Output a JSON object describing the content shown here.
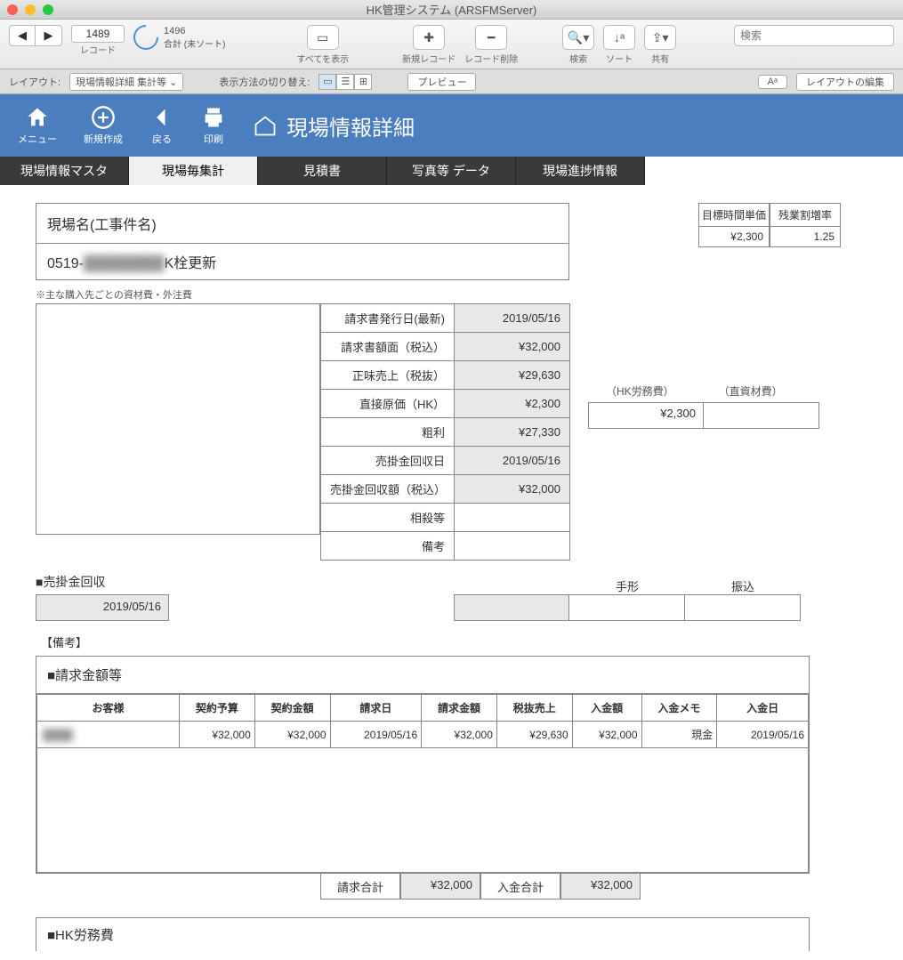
{
  "window": {
    "title": "HK管理システム (ARSFMServer)"
  },
  "toolbar": {
    "record_num": "1489",
    "record_total": "1496",
    "record_sort": "合計 (未ソート)",
    "record_label": "レコード",
    "show_all": "すべてを表示",
    "new_record": "新規レコード",
    "delete_record": "レコード削除",
    "search": "検索",
    "sort": "ソート",
    "share": "共有",
    "search_placeholder": "検索"
  },
  "layoutbar": {
    "layout_label": "レイアウト:",
    "layout_value": "現場情報詳細  集計等",
    "view_label": "表示方法の切り替え:",
    "preview": "プレビュー",
    "font_btn": "Aᵃ",
    "edit_layout": "レイアウトの編集"
  },
  "bluehdr": {
    "menu": "メニュー",
    "new": "新規作成",
    "back": "戻る",
    "print": "印刷",
    "title": "現場情報詳細"
  },
  "tabs": [
    "現場情報マスタ",
    "現場毎集計",
    "見積書",
    "写真等 データ",
    "現場進捗情報"
  ],
  "active_tab": 1,
  "site": {
    "label": "現場名(工事件名)",
    "value_prefix": "0519-",
    "value_blur": "████████",
    "value_suffix": "K栓更新"
  },
  "rates": {
    "h1": "目標時間単価",
    "v1": "¥2,300",
    "h2": "残業割増率",
    "v2": "1.25"
  },
  "note": "※主な購入先ごとの資材費・外注費",
  "kv": [
    {
      "k": "請求書発行日(最新)",
      "v": "2019/05/16"
    },
    {
      "k": "請求書額面（税込）",
      "v": "¥32,000"
    },
    {
      "k": "正味売上（税抜）",
      "v": "¥29,630"
    },
    {
      "k": "直接原価（HK）",
      "v": "¥2,300"
    },
    {
      "k": "粗利",
      "v": "¥27,330"
    },
    {
      "k": "売掛金回収日",
      "v": "2019/05/16"
    },
    {
      "k": "売掛金回収額（税込）",
      "v": "¥32,000"
    },
    {
      "k": "相殺等",
      "v": "",
      "white": true
    },
    {
      "k": "備考",
      "v": "",
      "white": true
    }
  ],
  "ext": {
    "h1": "（HK労務費）",
    "h2": "（直資材費）",
    "v1": "¥2,300",
    "v2": ""
  },
  "ar": {
    "title": "■売掛金回収",
    "date": "2019/05/16",
    "h1": "手形",
    "h2": "振込"
  },
  "biko": "【備考】",
  "bill": {
    "title": "■請求金額等",
    "headers": [
      "お客様",
      "契約予算",
      "契約金額",
      "請求日",
      "請求金額",
      "税抜売上",
      "入金額",
      "入金メモ",
      "入金日"
    ],
    "row": {
      "customer": "████",
      "budget": "¥32,000",
      "contract": "¥32,000",
      "bill_date": "2019/05/16",
      "bill_amt": "¥32,000",
      "net": "¥29,630",
      "paid": "¥32,000",
      "memo": "現金",
      "paid_date": "2019/05/16"
    },
    "tot_bill_lbl": "請求合計",
    "tot_bill": "¥32,000",
    "tot_paid_lbl": "入金合計",
    "tot_paid": "¥32,000"
  },
  "hk_title": "■HK労務費"
}
